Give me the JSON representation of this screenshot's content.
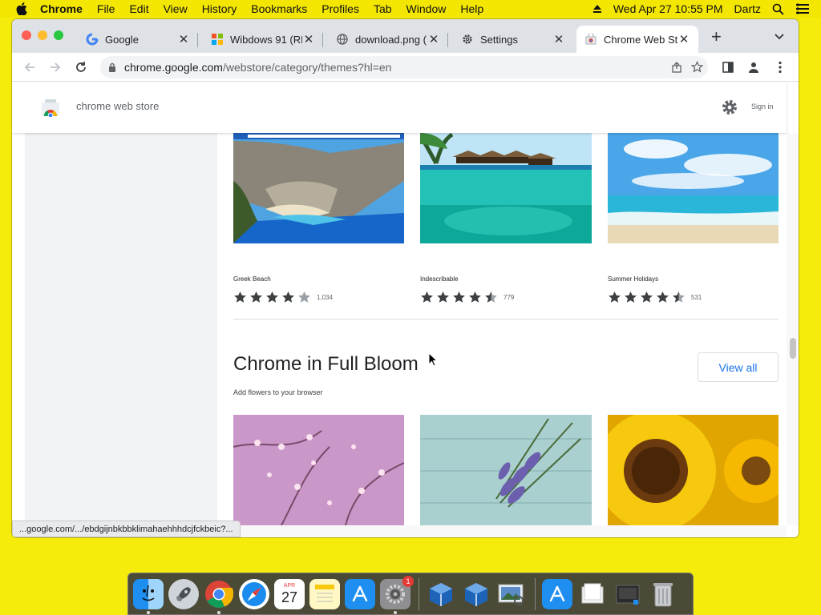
{
  "menubar": {
    "app_name": "Chrome",
    "items": [
      "File",
      "Edit",
      "View",
      "History",
      "Bookmarks",
      "Profiles",
      "Tab",
      "Window",
      "Help"
    ],
    "datetime": "Wed Apr 27  10:55 PM",
    "user": "Dartz"
  },
  "tabs": [
    {
      "label": "Google",
      "icon": "google-g-icon",
      "active": false
    },
    {
      "label": "Wibdows 91 (RE",
      "icon": "windows-logo-icon",
      "active": false
    },
    {
      "label": "download.png (",
      "icon": "globe-icon",
      "active": false
    },
    {
      "label": "Settings",
      "icon": "gear-icon",
      "active": false
    },
    {
      "label": "Chrome Web St",
      "icon": "webstore-icon",
      "active": true
    }
  ],
  "omnibox": {
    "host": "chrome.google.com",
    "path": "/webstore/category/themes?hl=en"
  },
  "store": {
    "title": "chrome web store",
    "sign_in": "Sign in"
  },
  "themes_row1": [
    {
      "name": "Greek Beach",
      "rating": 4,
      "count": "1,034"
    },
    {
      "name": "Indescribable",
      "rating": 4.5,
      "count": "779"
    },
    {
      "name": "Summer Holidays",
      "rating": 4.5,
      "count": "531"
    }
  ],
  "section": {
    "title": "Chrome in Full Bloom",
    "subtitle": "Add flowers to your browser",
    "view_all": "View all"
  },
  "status_url": "...google.com/.../ebdgijnbkbbklimahaehhhdcjfckbeic?...",
  "dock": {
    "calendar_month": "APR",
    "calendar_day": "27",
    "settings_badge": "1"
  },
  "colors": {
    "accent": "#1a73e8",
    "desktop": "#f5ec0b"
  }
}
